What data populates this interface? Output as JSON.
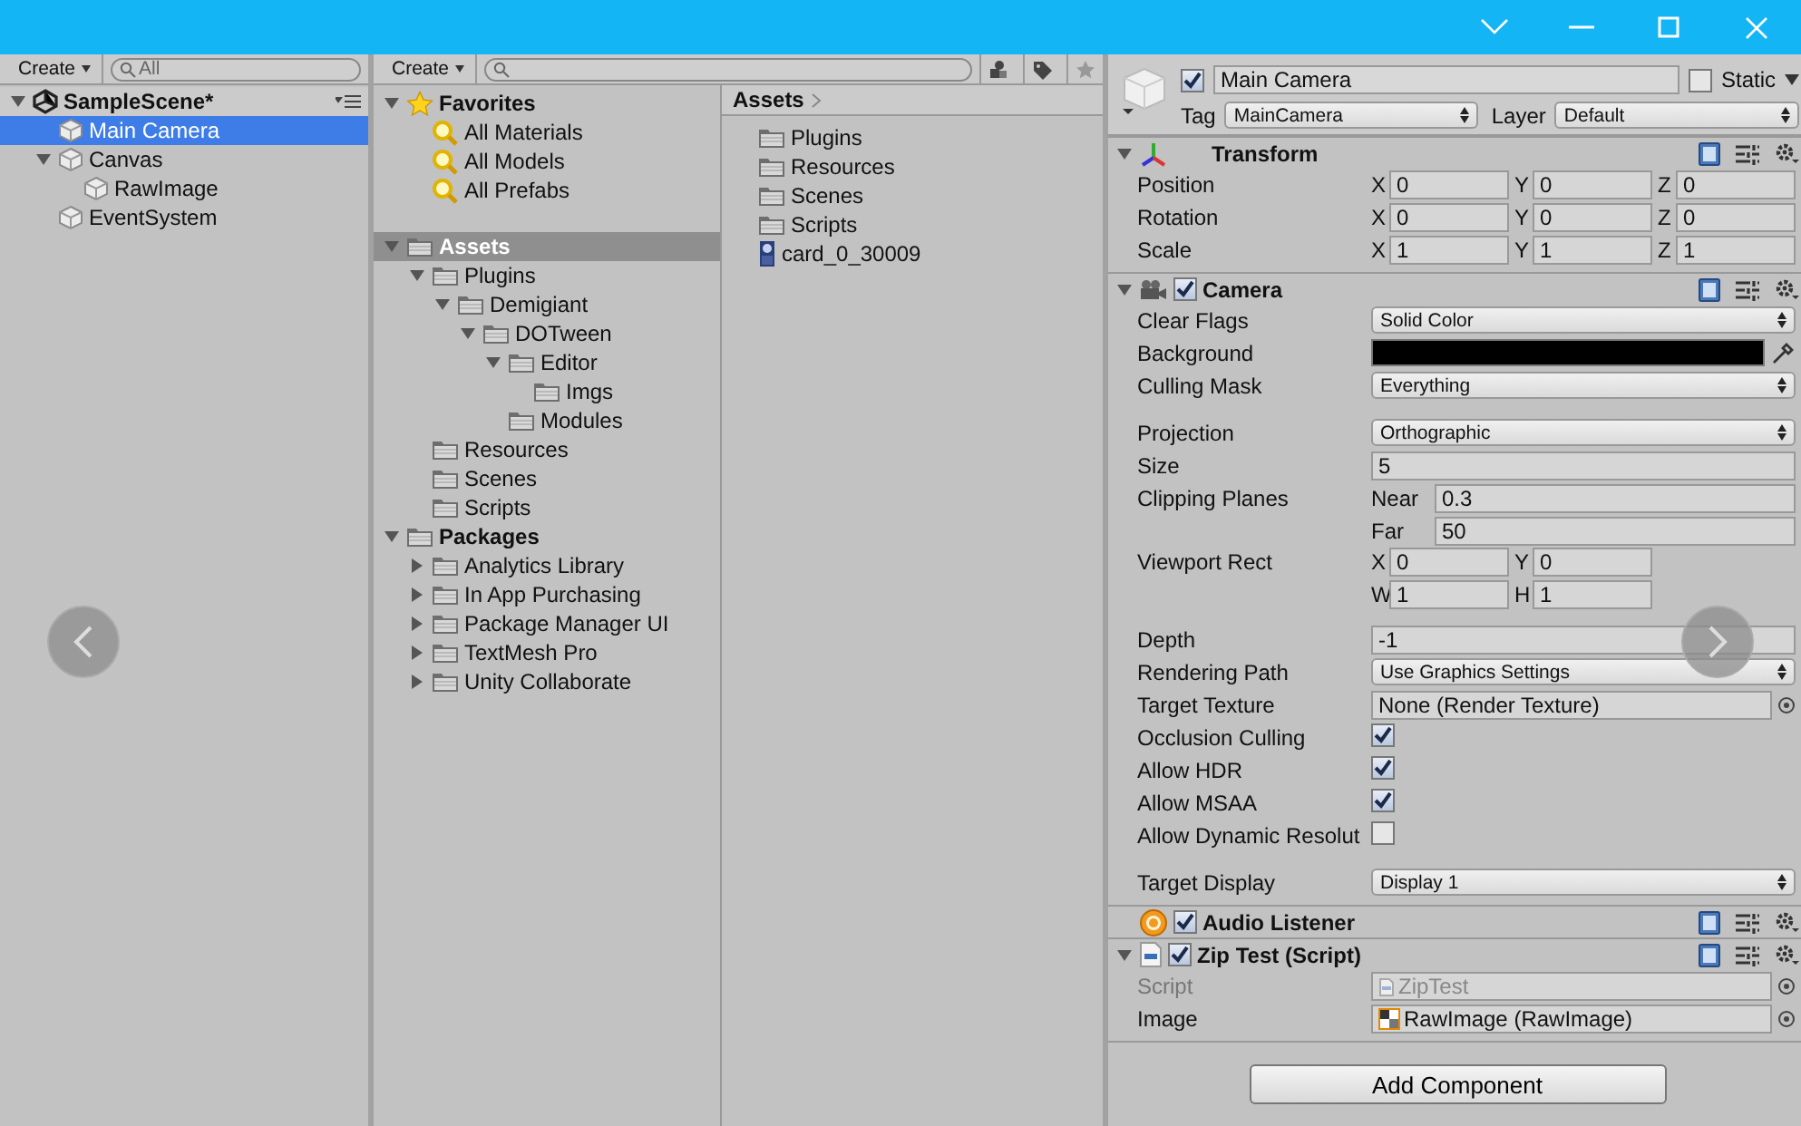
{
  "hierarchy": {
    "create_label": "Create",
    "search_placeholder": "All",
    "scene": {
      "label": "SampleScene*",
      "expanded": true
    },
    "items": [
      {
        "label": "Main Camera",
        "selected": true
      },
      {
        "label": "Canvas",
        "selected": false,
        "expanded": true,
        "children": [
          {
            "label": "RawImage",
            "selected": false
          }
        ]
      },
      {
        "label": "EventSystem",
        "selected": false
      }
    ]
  },
  "project": {
    "create_label": "Create",
    "tree": [
      {
        "label": "Favorites",
        "kind": "favorites",
        "expanded": true,
        "selected": false,
        "children": [
          {
            "label": "All Materials",
            "kind": "search",
            "selected": false
          },
          {
            "label": "All Models",
            "kind": "search",
            "selected": false
          },
          {
            "label": "All Prefabs",
            "kind": "search",
            "selected": false
          }
        ]
      },
      {
        "label": "Assets",
        "kind": "folder",
        "expanded": true,
        "selected": true,
        "children": [
          {
            "label": "Plugins",
            "kind": "folder",
            "expanded": true,
            "selected": false,
            "children": [
              {
                "label": "Demigiant",
                "kind": "folder",
                "expanded": true,
                "selected": false,
                "children": [
                  {
                    "label": "DOTween",
                    "kind": "folder",
                    "expanded": true,
                    "selected": false,
                    "children": [
                      {
                        "label": "Editor",
                        "kind": "folder",
                        "expanded": true,
                        "selected": false,
                        "children": [
                          {
                            "label": "Imgs",
                            "kind": "folder",
                            "selected": false
                          }
                        ]
                      },
                      {
                        "label": "Modules",
                        "kind": "folder",
                        "selected": false
                      }
                    ]
                  }
                ]
              }
            ]
          },
          {
            "label": "Resources",
            "kind": "folder",
            "selected": false
          },
          {
            "label": "Scenes",
            "kind": "folder",
            "selected": false
          },
          {
            "label": "Scripts",
            "kind": "folder",
            "selected": false
          }
        ]
      },
      {
        "label": "Packages",
        "kind": "folder",
        "expanded": true,
        "selected": false,
        "children": [
          {
            "label": "Analytics Library",
            "kind": "folder",
            "expanded": false,
            "selected": false
          },
          {
            "label": "In App Purchasing",
            "kind": "folder",
            "expanded": false,
            "selected": false
          },
          {
            "label": "Package Manager UI",
            "kind": "folder",
            "expanded": false,
            "selected": false
          },
          {
            "label": "TextMesh Pro",
            "kind": "folder",
            "expanded": false,
            "selected": false
          },
          {
            "label": "Unity Collaborate",
            "kind": "folder",
            "expanded": false,
            "selected": false
          }
        ]
      }
    ],
    "breadcrumb": "Assets",
    "files": [
      {
        "label": "Plugins",
        "kind": "folder"
      },
      {
        "label": "Resources",
        "kind": "folder"
      },
      {
        "label": "Scenes",
        "kind": "folder"
      },
      {
        "label": "Scripts",
        "kind": "folder"
      },
      {
        "label": "card_0_30009",
        "kind": "image"
      }
    ]
  },
  "inspector": {
    "active": true,
    "name": "Main Camera",
    "static_label": "Static",
    "static": false,
    "tag_label": "Tag",
    "tag": "MainCamera",
    "layer_label": "Layer",
    "layer": "Default",
    "components": [
      {
        "kind": "transform",
        "title": "Transform",
        "expanded": true,
        "rows": [
          {
            "kind": "vector",
            "label": "Position",
            "fields": [
              {
                "axis": "X",
                "value": "0"
              },
              {
                "axis": "Y",
                "value": "0"
              },
              {
                "axis": "Z",
                "value": "0"
              }
            ]
          },
          {
            "kind": "vector",
            "label": "Rotation",
            "fields": [
              {
                "axis": "X",
                "value": "0"
              },
              {
                "axis": "Y",
                "value": "0"
              },
              {
                "axis": "Z",
                "value": "0"
              }
            ]
          },
          {
            "kind": "vector",
            "label": "Scale",
            "fields": [
              {
                "axis": "X",
                "value": "1"
              },
              {
                "axis": "Y",
                "value": "1"
              },
              {
                "axis": "Z",
                "value": "1"
              }
            ]
          }
        ]
      },
      {
        "kind": "camera",
        "title": "Camera",
        "expanded": true,
        "enabled": true,
        "rows": [
          {
            "kind": "dropdown",
            "label": "Clear Flags",
            "value": "Solid Color"
          },
          {
            "kind": "color",
            "label": "Background"
          },
          {
            "kind": "dropdown",
            "label": "Culling Mask",
            "value": "Everything"
          },
          {
            "kind": "dropdown",
            "label": "Projection",
            "value": "Orthographic",
            "gap_before": true
          },
          {
            "kind": "field",
            "label": "Size",
            "value": "5"
          },
          {
            "kind": "pairs",
            "label": "Clipping Planes",
            "fields": [
              {
                "axis": "Near",
                "value": "0.3"
              },
              {
                "axis": "Far",
                "value": "50"
              }
            ]
          },
          {
            "kind": "rect",
            "label": "Viewport Rect",
            "fields": [
              {
                "axis": "X",
                "value": "0"
              },
              {
                "axis": "Y",
                "value": "0"
              },
              {
                "axis": "W",
                "value": "1"
              },
              {
                "axis": "H",
                "value": "1"
              }
            ]
          },
          {
            "kind": "field",
            "label": "Depth",
            "value": "-1",
            "gap_before": true
          },
          {
            "kind": "dropdown",
            "label": "Rendering Path",
            "value": "Use Graphics Settings"
          },
          {
            "kind": "object",
            "label": "Target Texture",
            "value": "None (Render Texture)",
            "disabled": false
          },
          {
            "kind": "checkbox",
            "label": "Occlusion Culling",
            "checked": true
          },
          {
            "kind": "checkbox",
            "label": "Allow HDR",
            "checked": true
          },
          {
            "kind": "checkbox",
            "label": "Allow MSAA",
            "checked": true
          },
          {
            "kind": "checkbox",
            "label": "Allow Dynamic Resolut",
            "checked": false
          },
          {
            "kind": "dropdown",
            "label": "Target Display",
            "value": "Display 1",
            "gap_before": true
          }
        ]
      },
      {
        "kind": "audio",
        "title": "Audio Listener",
        "enabled": true
      },
      {
        "kind": "script",
        "title": "Zip Test (Script)",
        "expanded": true,
        "enabled": true,
        "rows": [
          {
            "kind": "script",
            "label": "Script",
            "value": "ZipTest",
            "disabled": true
          },
          {
            "kind": "texture",
            "label": "Image",
            "value": "RawImage (RawImage)",
            "disabled": false
          }
        ]
      }
    ],
    "add_button": "Add Component"
  }
}
